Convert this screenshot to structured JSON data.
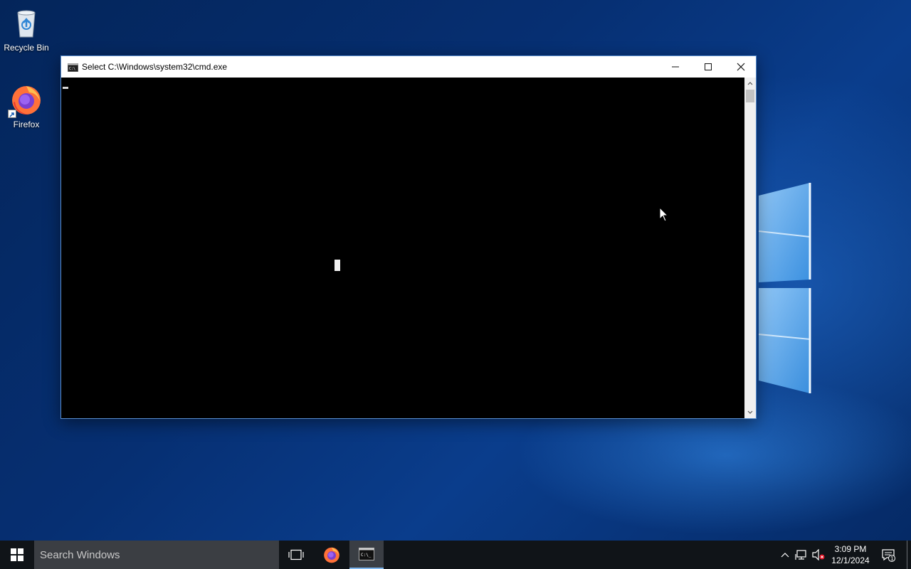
{
  "desktop": {
    "icons": [
      {
        "label": "Recycle Bin",
        "icon": "recycle-bin-icon"
      },
      {
        "label": "Firefox",
        "icon": "firefox-icon"
      }
    ]
  },
  "window": {
    "title": "Select C:\\Windows\\system32\\cmd.exe",
    "app_icon": "cmd-icon",
    "controls": {
      "minimize": "minimize-icon",
      "maximize": "maximize-icon",
      "close": "close-icon"
    }
  },
  "taskbar": {
    "search_placeholder": "Search Windows",
    "items": [
      {
        "name": "task-view",
        "icon": "task-view-icon"
      },
      {
        "name": "firefox",
        "icon": "firefox-icon"
      },
      {
        "name": "command-prompt",
        "icon": "cmd-icon",
        "active": true
      }
    ],
    "tray": {
      "time": "3:09 PM",
      "date": "12/1/2024",
      "notification_count": "1"
    }
  },
  "colors": {
    "accent": "#7fb7ef",
    "taskbar": "#101418",
    "console": "#000000"
  }
}
